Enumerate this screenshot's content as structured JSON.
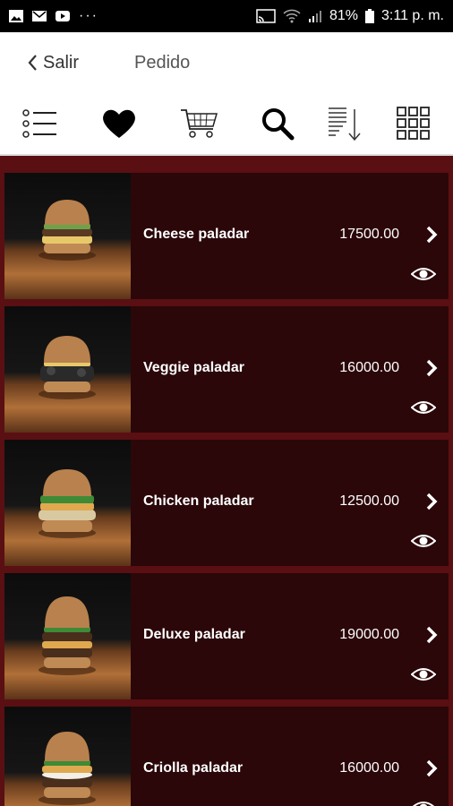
{
  "status_bar": {
    "battery": "81%",
    "time": "3:11 p. m.",
    "more": "···"
  },
  "header": {
    "back_label": "Salir",
    "title": "Pedido"
  },
  "toolbar": {
    "icons": [
      "menu-list-icon",
      "heart-icon",
      "cart-icon",
      "search-icon",
      "sort-icon",
      "grid-icon"
    ]
  },
  "colors": {
    "page_bg": "#5a0f12",
    "card_bg": "#2b0709",
    "text": "#ffffff"
  },
  "products": [
    {
      "name": "Cheese paladar",
      "price": "17500.00"
    },
    {
      "name": "Veggie paladar",
      "price": "16000.00"
    },
    {
      "name": "Chicken paladar",
      "price": "12500.00"
    },
    {
      "name": "Deluxe paladar",
      "price": "19000.00"
    },
    {
      "name": "Criolla paladar",
      "price": "16000.00"
    }
  ]
}
